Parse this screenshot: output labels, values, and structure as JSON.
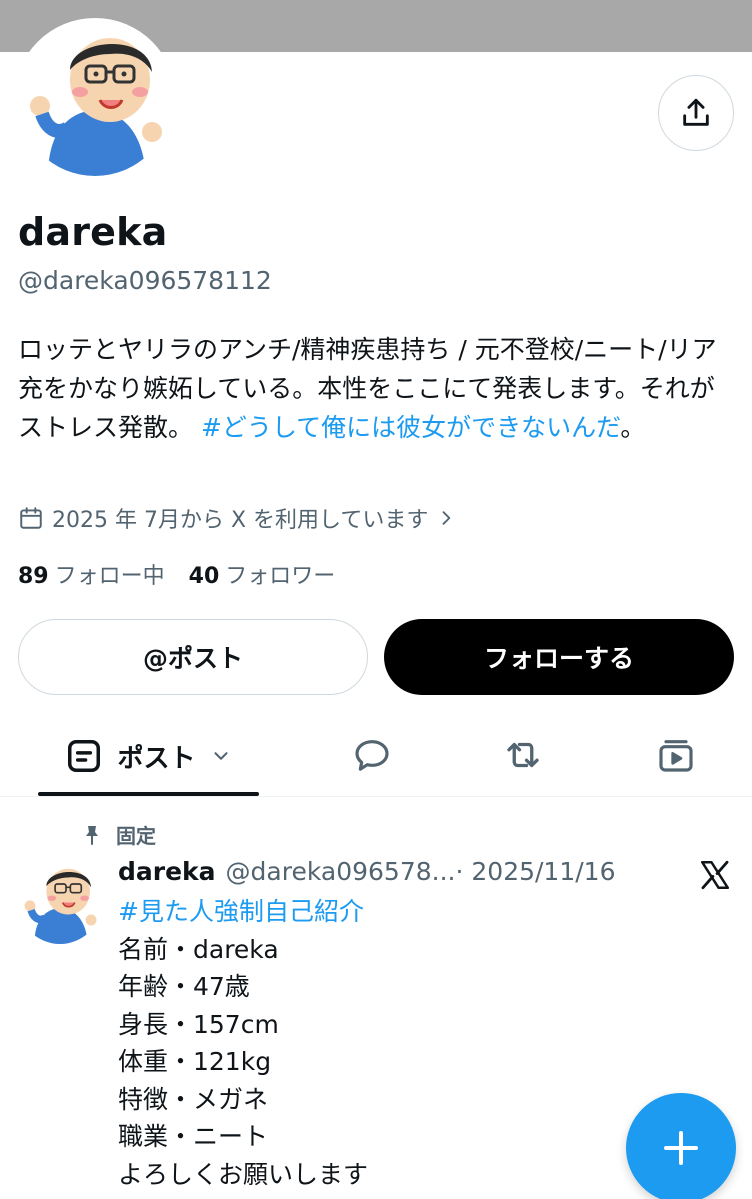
{
  "profile": {
    "display_name": "dareka",
    "handle": "@dareka096578112",
    "bio_text": "ロッテとヤリラのアンチ/精神疾患持ち / 元不登校/ニート/リア充をかなり嫉妬している。本性をここにて発表します。それがストレス発散。 ",
    "bio_hashtag": "#どうして俺には彼女ができないんだ",
    "bio_end": "。",
    "joined": "2025 年 7月から X を利用しています",
    "following_count": "89",
    "following_label": "フォロー中",
    "followers_count": "40",
    "followers_label": "フォロワー"
  },
  "buttons": {
    "mention_label": "@ポスト",
    "follow_label": "フォローする"
  },
  "tabs": {
    "posts_label": "ポスト"
  },
  "pinned_post": {
    "pinned_label": "固定",
    "author_name": "dareka",
    "author_handle": "@dareka096578...",
    "date": "· 2025/11/16",
    "hashtag": "#見た人強制自己紹介",
    "lines": [
      "名前・dareka",
      "年齢・47歳",
      "身長・157cm",
      "体重・121kg",
      "特徴・メガネ",
      "職業・ニート",
      "よろしくお願いします"
    ]
  },
  "colors": {
    "accent": "#1d9bf0",
    "text": "#0f1419",
    "secondary": "#536471",
    "banner": "#a8a8a8"
  },
  "icons": [
    "share-icon",
    "calendar-icon",
    "chevron-right-icon",
    "posts-tab-icon",
    "chevron-down-icon",
    "reply-icon",
    "repost-icon",
    "media-icon",
    "pin-icon",
    "x-logo-icon",
    "plus-icon"
  ]
}
